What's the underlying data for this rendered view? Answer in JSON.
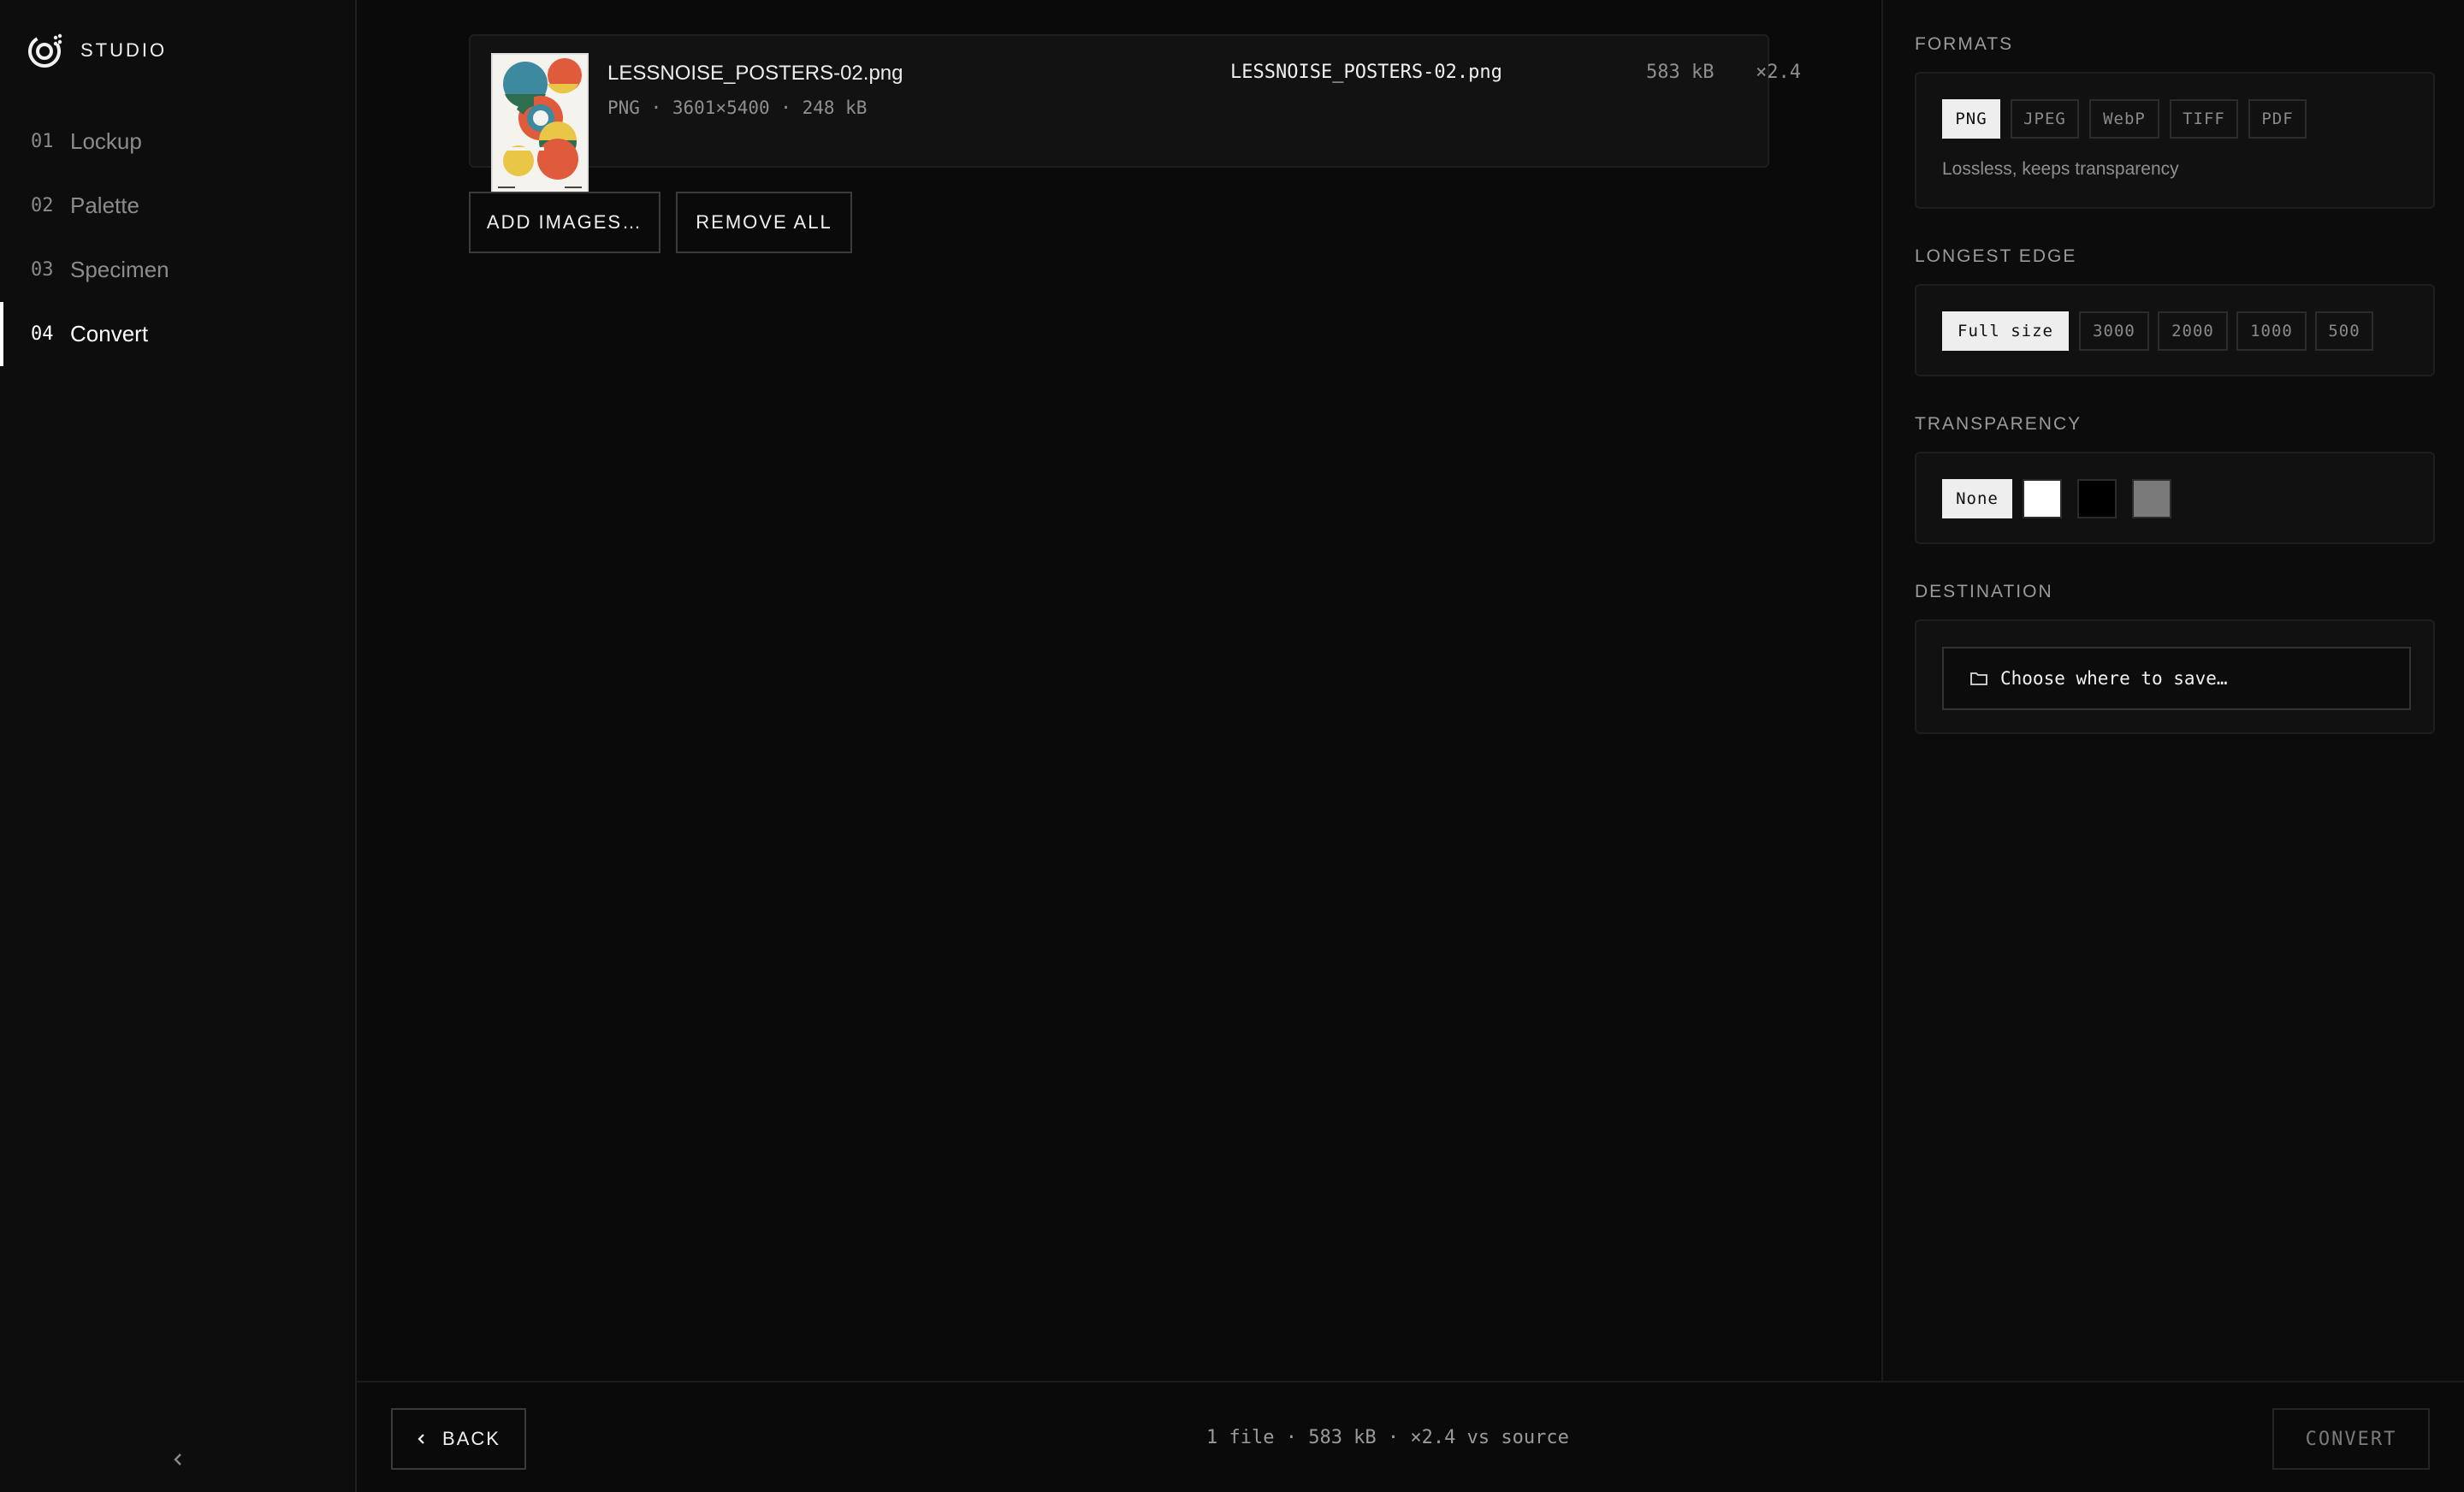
{
  "brand": {
    "name": "STUDIO",
    "logo_icon": "studio-logo-icon"
  },
  "nav": {
    "items": [
      {
        "num": "01",
        "label": "Lockup"
      },
      {
        "num": "02",
        "label": "Palette"
      },
      {
        "num": "03",
        "label": "Specimen"
      },
      {
        "num": "04",
        "label": "Convert"
      }
    ],
    "active_index": 3,
    "collapse_icon": "chevron-left-icon"
  },
  "file": {
    "name": "LESSNOISE_POSTERS-02.png",
    "meta": "PNG · 3601×5400 · 248 kB",
    "output_name": "LESSNOISE_POSTERS-02.png",
    "output_size": "583 kB",
    "output_ratio": "×2.4"
  },
  "actions": {
    "add_label": "ADD IMAGES…",
    "remove_label": "REMOVE ALL"
  },
  "formats": {
    "title": "FORMATS",
    "options": [
      "PNG",
      "JPEG",
      "WebP",
      "TIFF",
      "PDF"
    ],
    "selected": "PNG",
    "description": "Lossless, keeps transparency"
  },
  "longest_edge": {
    "title": "LONGEST EDGE",
    "options": [
      "Full size",
      "3000",
      "2000",
      "1000",
      "500"
    ],
    "selected": "Full size"
  },
  "transparency": {
    "title": "TRANSPARENCY",
    "none_label": "None",
    "swatches": [
      "#ffffff",
      "#000000",
      "#7a7a7a"
    ]
  },
  "destination": {
    "title": "DESTINATION",
    "button_label": "Choose where to save…",
    "icon": "folder-icon"
  },
  "footer": {
    "back_label": "BACK",
    "summary": "1 file · 583 kB · ×2.4 vs source",
    "convert_label": "CONVERT"
  }
}
